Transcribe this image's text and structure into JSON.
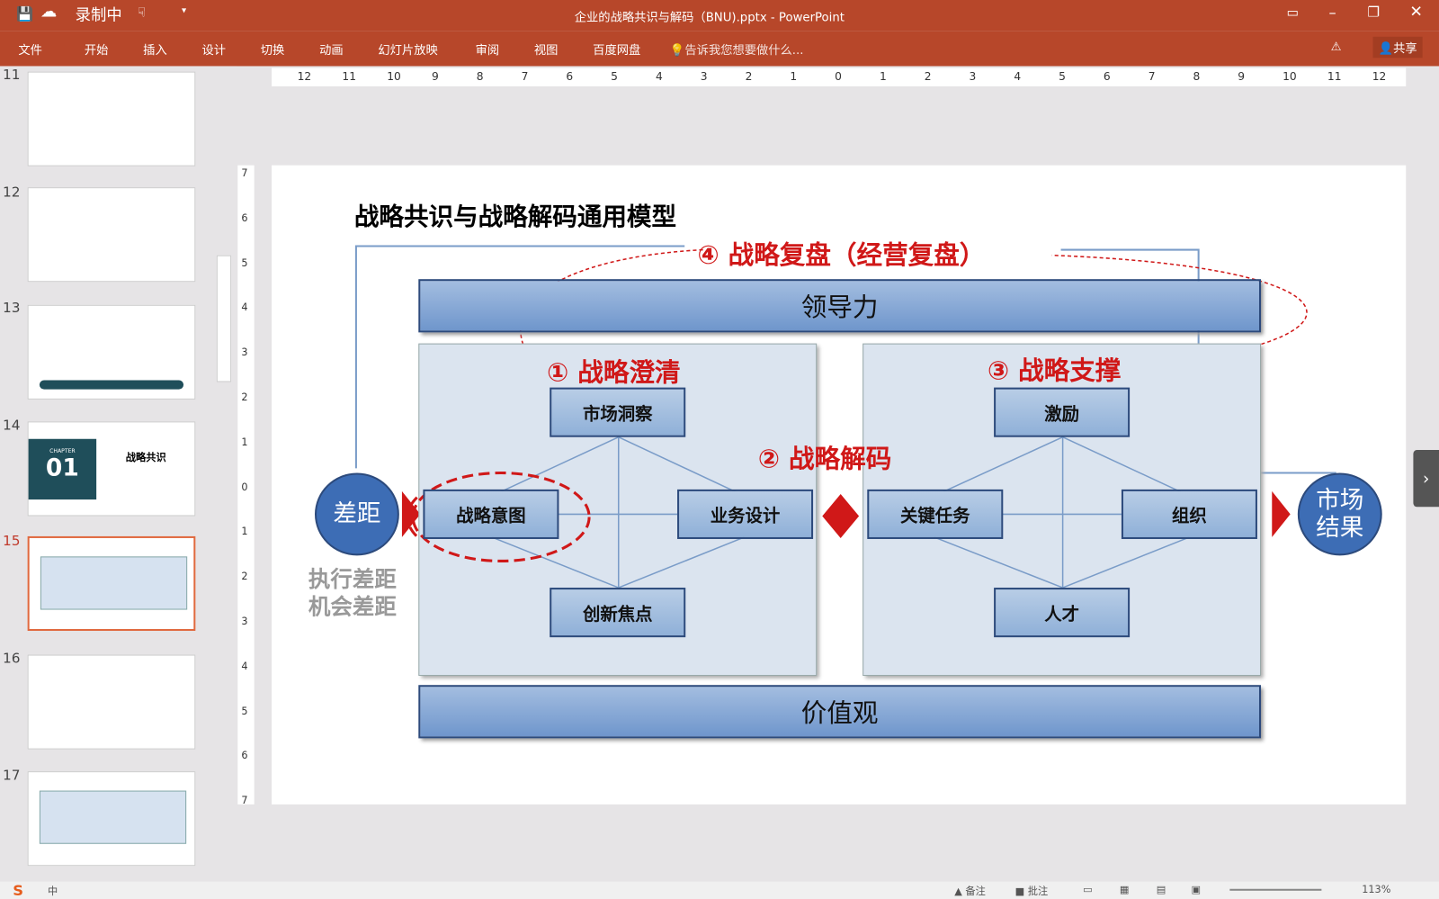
{
  "titlebar": {
    "recording": "录制中",
    "doc_title": "企业的战略共识与解码（BNU).pptx - PowerPoint"
  },
  "ribbon": {
    "tabs": [
      "文件",
      "开始",
      "插入",
      "设计",
      "切换",
      "动画",
      "幻灯片放映",
      "审阅",
      "视图",
      "百度网盘"
    ],
    "tell_me": "告诉我您想要做什么...",
    "share": "共享"
  },
  "thumbnails": [
    {
      "num": "11"
    },
    {
      "num": "12"
    },
    {
      "num": "13"
    },
    {
      "num": "14",
      "chapter": "CHAPTER",
      "chapter_num": "01",
      "label": "战略共识"
    },
    {
      "num": "15",
      "selected": true
    },
    {
      "num": "16"
    },
    {
      "num": "17"
    }
  ],
  "ruler_h": [
    "12",
    "11",
    "10",
    "9",
    "8",
    "7",
    "6",
    "5",
    "4",
    "3",
    "2",
    "1",
    "0",
    "1",
    "2",
    "3",
    "4",
    "5",
    "6",
    "7",
    "8",
    "9",
    "10",
    "11",
    "12"
  ],
  "ruler_v": [
    "7",
    "6",
    "5",
    "4",
    "3",
    "2",
    "1",
    "0",
    "1",
    "2",
    "3",
    "4",
    "5",
    "6",
    "7"
  ],
  "slide": {
    "title": "战略共识与战略解码通用模型",
    "review": "④  战略复盘（经营复盘）",
    "leadership": "领导力",
    "values": "价值观",
    "clarify": "①  战略澄清",
    "decode": "②  战略解码",
    "support": "③  战略支撑",
    "left_boxes": {
      "top": "市场洞察",
      "left": "战略意图",
      "right": "业务设计",
      "bottom": "创新焦点"
    },
    "right_boxes": {
      "top": "激励",
      "left": "关键任务",
      "right": "组织",
      "bottom": "人才"
    },
    "gap": "差距",
    "gap_types": [
      "执行差距",
      "机会差距"
    ],
    "result": [
      "市场",
      "结果"
    ]
  },
  "statusbar": {
    "notes": "备注",
    "comments": "批注",
    "zoom": "113%",
    "ime": "中"
  },
  "colors": {
    "accent": "#b7472a",
    "red": "#d01818",
    "blue": "#3d6db5"
  }
}
